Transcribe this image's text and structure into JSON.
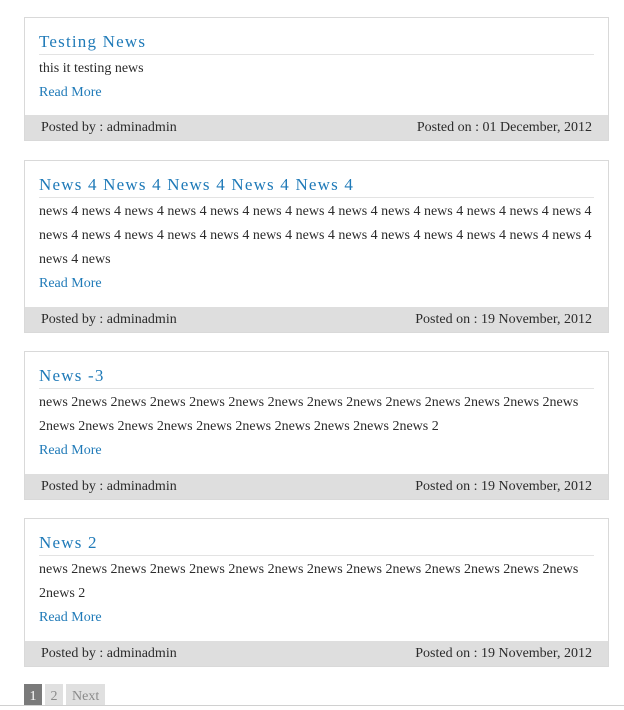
{
  "posts": [
    {
      "title": "Testing News",
      "text": "this it testing news",
      "read_more": "Read More",
      "posted_by": "Posted by : adminadmin",
      "posted_on": "Posted on : 01 December, 2012"
    },
    {
      "title": "News 4 News 4 News 4 News 4 News 4",
      "text": "news 4 news 4 news 4 news 4 news 4 news 4 news 4 news 4 news 4 news 4 news 4 news 4 news 4 news 4 news 4 news 4 news 4 news 4 news 4 news 4 news 4 news 4 news 4 news 4 news 4 news 4 news 4 news",
      "read_more": "Read More",
      "posted_by": "Posted by : adminadmin",
      "posted_on": "Posted on : 19 November, 2012"
    },
    {
      "title": "News -3",
      "text": "news 2news 2news 2news 2news 2news 2news 2news 2news 2news 2news 2news 2news 2news 2news 2news 2news 2news 2news 2news 2news 2news 2news 2news 2",
      "read_more": "Read More",
      "posted_by": "Posted by : adminadmin",
      "posted_on": "Posted on : 19 November, 2012"
    },
    {
      "title": "News 2",
      "text": "news 2news 2news 2news 2news 2news 2news 2news 2news 2news 2news 2news 2news 2news 2news 2",
      "read_more": "Read More",
      "posted_by": "Posted by : adminadmin",
      "posted_on": "Posted on : 19 November, 2012"
    }
  ],
  "pagination": {
    "pages": [
      "1",
      "2"
    ],
    "active": "1",
    "next_label": "Next"
  },
  "colors": {
    "link": "#1f7ab8",
    "footer_bg": "#dedede",
    "pager_active": "#7a7a7a"
  }
}
